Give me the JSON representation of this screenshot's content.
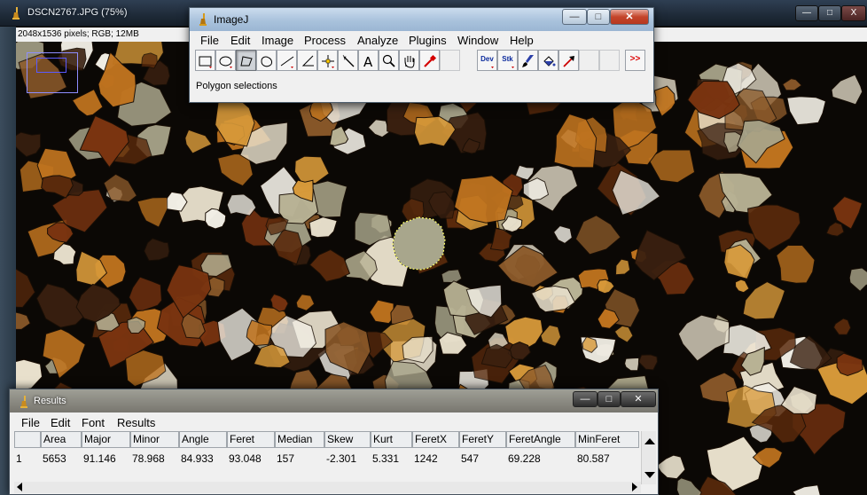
{
  "image_window": {
    "title": "DSCN2767.JPG (75%)",
    "info": "2048x1536 pixels; RGB; 12MB",
    "controls": {
      "minimize": "—",
      "maximize": "□",
      "close": "X"
    }
  },
  "imagej": {
    "title": "ImageJ",
    "menu": [
      "File",
      "Edit",
      "Image",
      "Process",
      "Analyze",
      "Plugins",
      "Window",
      "Help"
    ],
    "tools": [
      "rectangle-tool",
      "oval-tool",
      "polygon-tool",
      "freehand-tool",
      "straight-line-tool",
      "angle-tool",
      "point-tool",
      "wand-tool",
      "text-tool",
      "magnifying-glass-tool",
      "scrolling-tool",
      "color-picker-tool",
      "blank",
      "developer-menu",
      "stacks-menu",
      "brush-tool",
      "flood-filler-tool",
      "arrow-tool",
      "blank",
      "blank",
      "more-tools"
    ],
    "dev_label": "Dev",
    "stk_label": "Stk",
    "more_label": ">>",
    "status": "Polygon selections",
    "controls": {
      "minimize": "—",
      "maximize": "□",
      "close": "✕"
    }
  },
  "results": {
    "title": "Results",
    "menu": [
      "File",
      "Edit",
      "Font",
      "Results"
    ],
    "columns": [
      "",
      "Area",
      "Major",
      "Minor",
      "Angle",
      "Feret",
      "Median",
      "Skew",
      "Kurt",
      "FeretX",
      "FeretY",
      "FeretAngle",
      "MinFeret"
    ],
    "rows": [
      [
        "1",
        "5653",
        "91.146",
        "78.968",
        "84.933",
        "93.048",
        "157",
        "-2.301",
        "5.331",
        "1242",
        "547",
        "69.228",
        "80.587"
      ]
    ],
    "controls": {
      "minimize": "—",
      "maximize": "□",
      "close": "✕"
    }
  },
  "colors": {
    "grain_dark": "#7a3410",
    "grain_amber": "#c0741f",
    "grain_pale": "#e8e0cc",
    "grain_grey": "#a8a48a",
    "background": "#0b0805",
    "titlebar_imagej": "#a9c2dc",
    "close_red": "#c4452a"
  }
}
